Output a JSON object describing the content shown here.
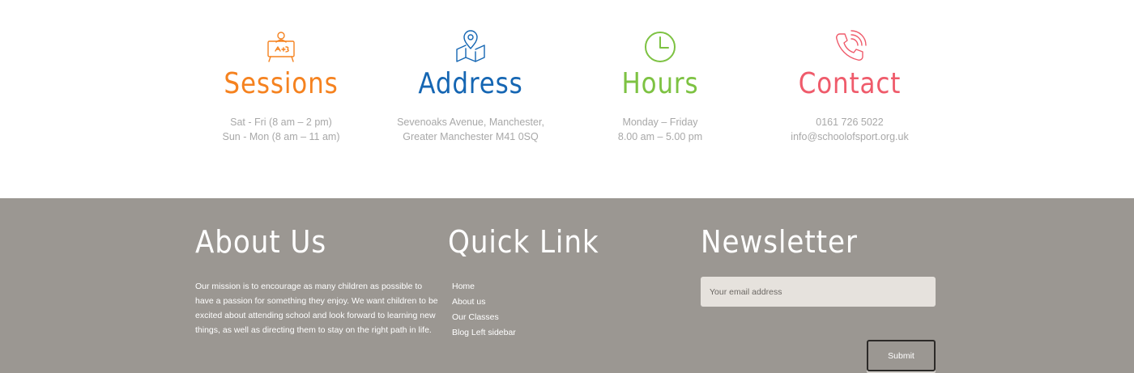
{
  "info": [
    {
      "key": "sessions",
      "icon": "whiteboard-teacher-icon",
      "title": "Sessions",
      "color": "#f5821f",
      "lines": [
        "Sat - Fri (8 am – 2 pm)",
        "Sun - Mon (8 am – 11 am)"
      ]
    },
    {
      "key": "address",
      "icon": "map-pin-icon",
      "title": "Address",
      "color": "#1566b3",
      "lines": [
        "Sevenoaks Avenue, Manchester,",
        "Greater Manchester M41 0SQ"
      ]
    },
    {
      "key": "hours",
      "icon": "clock-icon",
      "title": "Hours",
      "color": "#7dc242",
      "lines": [
        "Monday – Friday",
        "8.00 am – 5.00 pm"
      ]
    },
    {
      "key": "contact",
      "icon": "phone-icon",
      "title": "Contact",
      "color": "#ef5b6b",
      "lines": [
        "0161 726 5022",
        "info@schoolofsport.org.uk"
      ]
    }
  ],
  "footer": {
    "background": "#9b9792",
    "about": {
      "title": "About Us",
      "text": "Our mission is to encourage as many children as possible to have a passion for something they enjoy. We want children to be excited about attending school and look forward to learning new things, as well as directing them to stay on the right path in life."
    },
    "quick": {
      "title": "Quick Link",
      "links": [
        "Home",
        "About us",
        "Our Classes",
        "Blog Left sidebar"
      ]
    },
    "newsletter": {
      "title": "Newsletter",
      "placeholder": "Your email address",
      "submit_label": "Submit"
    }
  }
}
